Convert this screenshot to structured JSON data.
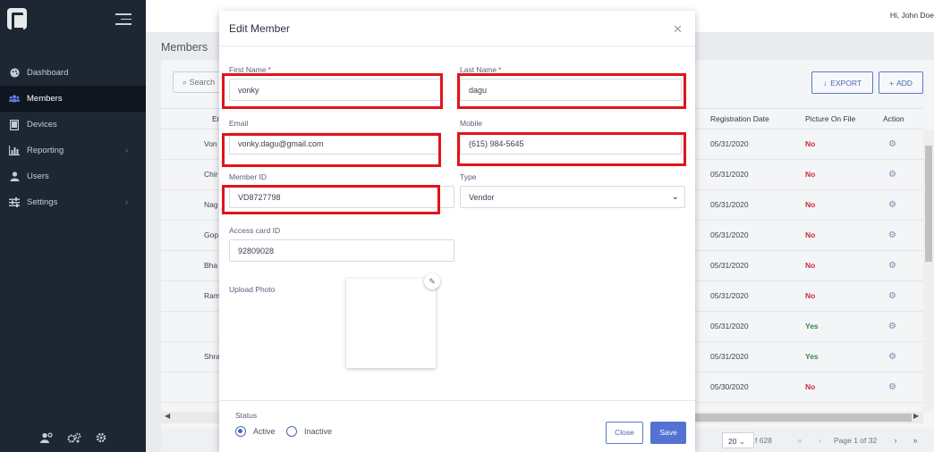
{
  "header": {
    "greeting": "Hi, John Doe"
  },
  "sidebar": {
    "items": [
      {
        "label": "Dashboard",
        "icon": "palette-icon"
      },
      {
        "label": "Members",
        "icon": "users-icon"
      },
      {
        "label": "Devices",
        "icon": "tablet-icon"
      },
      {
        "label": "Reporting",
        "icon": "bar-chart-icon"
      },
      {
        "label": "Users",
        "icon": "user-icon"
      },
      {
        "label": "Settings",
        "icon": "sliders-icon"
      }
    ],
    "active": "Members",
    "bottom_icons": [
      "user-cog-icon",
      "cogs-icon",
      "gear-icon"
    ]
  },
  "page": {
    "title": "Members",
    "search_placeholder": "Search",
    "export_label": "EXPORT",
    "add_label": "ADD",
    "columns": [
      "En",
      "Registration Date",
      "Picture On File",
      "Action"
    ],
    "rows": [
      {
        "name": "Von",
        "date": "05/31/2020",
        "picture": "No"
      },
      {
        "name": "Chir",
        "date": "05/31/2020",
        "picture": "No"
      },
      {
        "name": "Nag",
        "date": "05/31/2020",
        "picture": "No"
      },
      {
        "name": "Gop",
        "date": "05/31/2020",
        "picture": "No"
      },
      {
        "name": "Bha",
        "date": "05/31/2020",
        "picture": "No"
      },
      {
        "name": "Ram",
        "date": "05/31/2020",
        "picture": "No"
      },
      {
        "name": "",
        "date": "05/31/2020",
        "picture": "Yes"
      },
      {
        "name": "Shra",
        "date": "05/31/2020",
        "picture": "Yes"
      },
      {
        "name": "",
        "date": "05/30/2020",
        "picture": "No"
      }
    ],
    "pagination": {
      "page_size": "20",
      "of_total": "f 628",
      "page_text": "Page 1 of 32"
    }
  },
  "modal": {
    "title": "Edit Member",
    "first_name_label": "First Name",
    "first_name": "vonky",
    "last_name_label": "Last Name",
    "last_name": "dagu",
    "email_label": "Email",
    "email": "vonky.dagu@gmail.com",
    "mobile_label": "Mobile",
    "mobile": "(615) 984-5645",
    "member_id_label": "Member ID",
    "member_id": "VD8727798",
    "type_label": "Type",
    "type_value": "Vendor",
    "access_card_label": "Access card ID",
    "access_card": "92809028",
    "upload_photo_label": "Upload Photo",
    "status_label": "Status",
    "status_options": [
      "Active",
      "Inactive"
    ],
    "status_selected": "Active",
    "close_label": "Close",
    "save_label": "Save",
    "highlight_color": "#e0141b",
    "accent_color": "#5472d3"
  }
}
